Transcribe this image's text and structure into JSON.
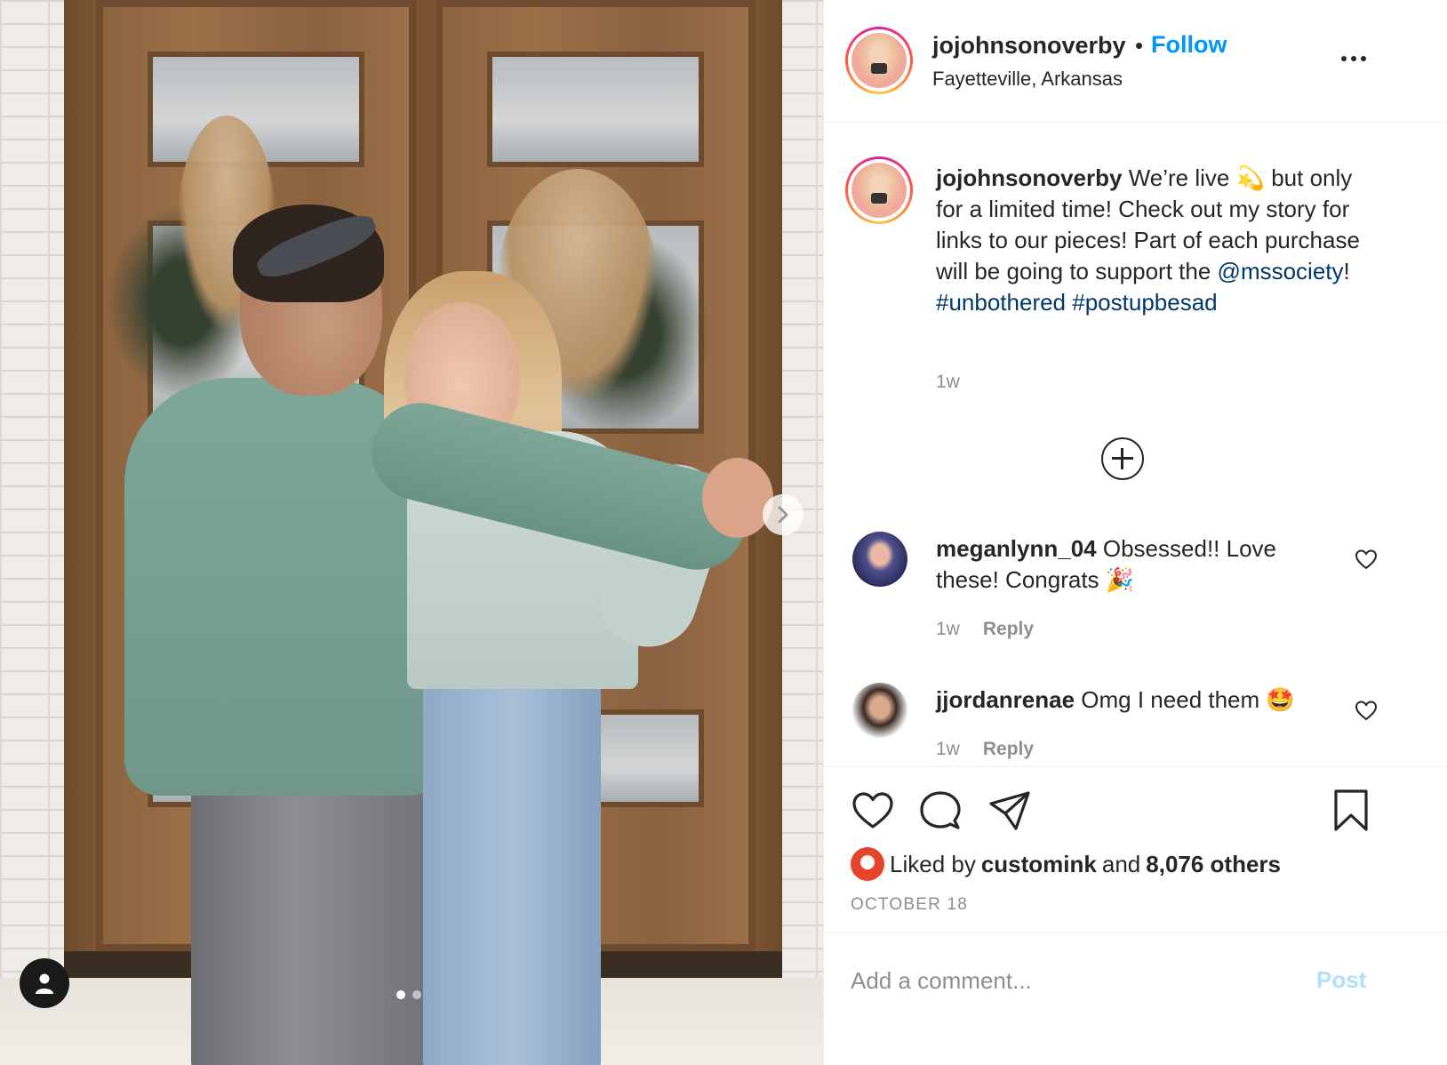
{
  "header": {
    "username": "jojohnsonoverby",
    "separator": "•",
    "follow_label": "Follow",
    "location": "Fayetteville, Arkansas",
    "more_icon": "more-horizontal-icon"
  },
  "caption": {
    "username": "jojohnsonoverby",
    "text_part1": "We’re live",
    "emoji": "💫",
    "text_part2": "but only for a limited time! Check out my story for links to our pieces! Part of each purchase will be going to support the",
    "mention": "@mssociety",
    "bang": "!",
    "hashtag1": "#unbothered",
    "hashtag2": "#postupbesad",
    "time": "1w"
  },
  "comments": [
    {
      "username": "meganlynn_04",
      "text": "Obsessed!! Love these! Congrats",
      "emoji": "🎉",
      "time": "1w",
      "reply_label": "Reply"
    },
    {
      "username": "jjordanrenae",
      "text": "Omg I need them",
      "emoji": "🤩",
      "time": "1w",
      "reply_label": "Reply"
    }
  ],
  "actions": {
    "liked_prefix": "Liked by",
    "liked_user": "customink",
    "liked_and": "and",
    "liked_others": "8,076 others",
    "date": "OCTOBER 18"
  },
  "composer": {
    "placeholder": "Add a comment...",
    "post_label": "Post"
  },
  "carousel": {
    "slides": 2,
    "active_slide": 1
  },
  "colors": {
    "accent": "#0095f6",
    "link": "#00376b",
    "muted": "#8e8e8e",
    "post_disabled": "#b2dffc"
  }
}
